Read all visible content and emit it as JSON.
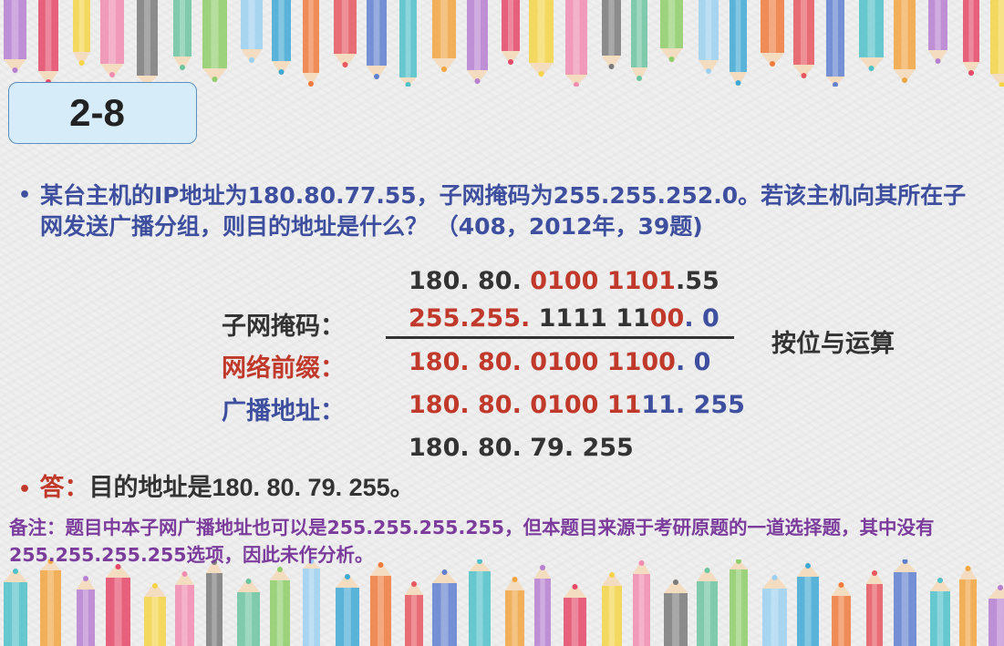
{
  "badge": {
    "label": "2-8"
  },
  "question": {
    "bullet": "•",
    "text": "某台主机的IP地址为180.80.77.55，子网掩码为255.255.252.0。若该主机向其所在子网发送广播分组，则目的地址是什么？ （408，2012年，39题)"
  },
  "calc": {
    "ip": {
      "prefix": "180.  80. ",
      "bits_a": "0100 ",
      "bits_b": "1101",
      "suffix": ".55"
    },
    "mask": {
      "label": "子网掩码：",
      "prefix": "255.255. ",
      "bits_a": "1111 ",
      "bits_b": "11",
      "bits_c": "00",
      "suffix": ". 0"
    },
    "network": {
      "label": "网络前缀：",
      "prefix": "180.  80. ",
      "bits_a": "0100 ",
      "bits_b": "1100",
      "suffix": ". 0"
    },
    "broadcast": {
      "label": "广播地址：",
      "prefix": "180.  80. ",
      "bits_a": "0100 ",
      "bits_b": "11",
      "bits_c": "11",
      "suffix": ". 255"
    },
    "result": "180.  80. 79. 255",
    "operation": "按位与运算"
  },
  "answer": {
    "bullet": "•",
    "label": "答：",
    "text_a": "目的地址是",
    "text_b": "180.  80. 79. 255。"
  },
  "note": {
    "text": "备注：题目中本子网广播地址也可以是255.255.255.255，但本题目来源于考研原题的一道选择题，其中没有255.255.255.255选项，因此未作分析。"
  },
  "colors": {
    "dark": "#333333",
    "red": "#c0392b",
    "blue": "#3d4f9e",
    "purple": "#7b3c9c",
    "badge_bg": "#d6ecf8"
  }
}
